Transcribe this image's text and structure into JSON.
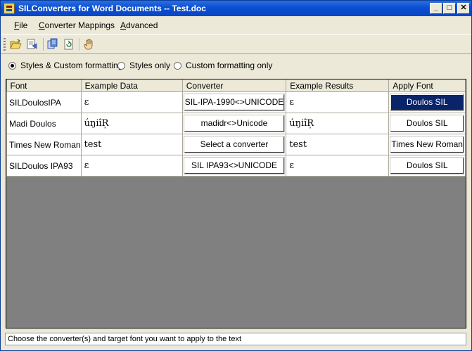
{
  "window": {
    "title": "SILConverters for Word Documents -- Test.doc",
    "controls": {
      "minimize": "_",
      "maximize": "□",
      "close": "✕"
    }
  },
  "menu": [
    {
      "label": "File",
      "underline": "F",
      "rest": "ile"
    },
    {
      "label": "Converter Mappings",
      "underline": "C",
      "rest": "onverter Mappings"
    },
    {
      "label": "Advanced",
      "underline": "A",
      "rest": "dvanced"
    }
  ],
  "toolbar": {
    "icons": [
      "open-folder-icon",
      "save-document-icon",
      "convert-document-icon",
      "refresh-icon",
      "stop-hand-icon"
    ]
  },
  "options": [
    {
      "label": "Styles & Custom formatting",
      "selected": true
    },
    {
      "label": "Styles only",
      "selected": false
    },
    {
      "label": "Custom formatting only",
      "selected": false
    }
  ],
  "grid": {
    "columns": [
      "Font",
      "Example Data",
      "Converter",
      "Example Results",
      "Apply Font"
    ],
    "rows": [
      {
        "font": "SILDoulosIPA",
        "example": "ɛ",
        "converter": "SIL-IPA-1990<>UNICODE",
        "result": "ɛ",
        "apply_font": "Doulos SIL",
        "selected": true
      },
      {
        "font": "Madi Doulos",
        "example": "úŋiîR̩",
        "converter": "madidr<>Unicode",
        "result": "úŋiîR̩",
        "apply_font": "Doulos SIL",
        "selected": false
      },
      {
        "font": "Times New Roman",
        "example": "test",
        "converter": "Select a converter",
        "result": "test",
        "apply_font": "Times New Roman",
        "selected": false
      },
      {
        "font": "SILDoulos IPA93",
        "example": "ɛ",
        "converter": "SIL IPA93<>UNICODE",
        "result": "ɛ",
        "apply_font": "Doulos SIL",
        "selected": false
      }
    ]
  },
  "status": "Choose the converter(s) and target font you want to apply to the text",
  "colors": {
    "title_bar": "#0a4fd2",
    "selection": "#0a246a",
    "grid_background": "#808080"
  }
}
